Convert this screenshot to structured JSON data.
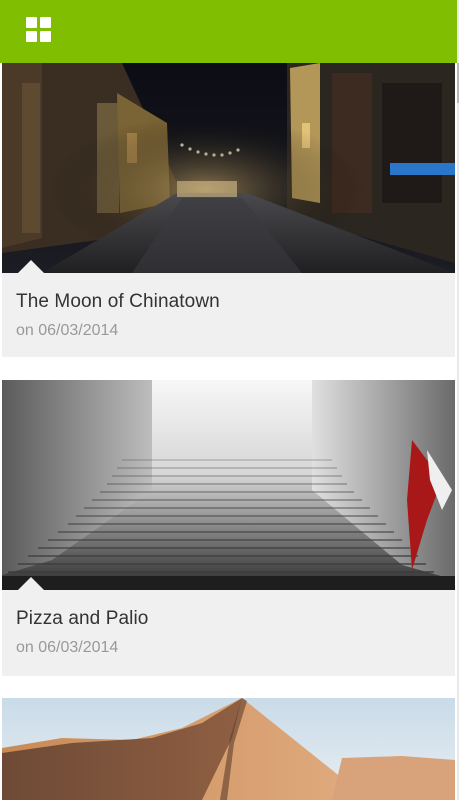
{
  "header": {
    "menu_icon": "grid-icon",
    "accent_color": "#7fbe00"
  },
  "posts": [
    {
      "title": "The Moon of Chinatown",
      "date": "on 06/03/2014"
    },
    {
      "title": "Pizza and Palio",
      "date": "on 06/03/2014"
    },
    {
      "title": "",
      "date": ""
    }
  ]
}
